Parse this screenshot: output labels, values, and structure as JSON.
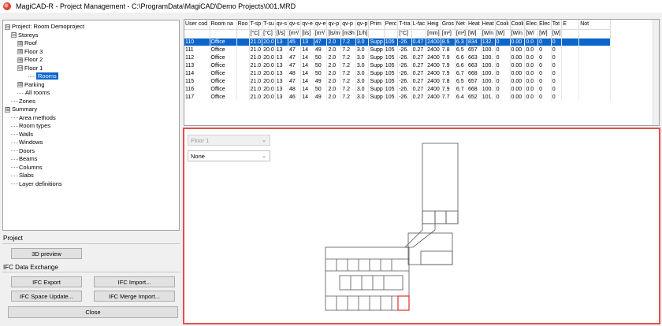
{
  "window": {
    "title": "MagiCAD-R - Project Management - C:\\ProgramData\\MagiCAD\\Demo Projects\\001.MRD"
  },
  "tree": {
    "items": [
      {
        "label": "Project: Room Demoproject",
        "toggle": "⊟"
      },
      {
        "label": "Storeys",
        "toggle": "⊟"
      },
      {
        "label": "Roof",
        "toggle": "⊞"
      },
      {
        "label": "Floor 3",
        "toggle": "⊞"
      },
      {
        "label": "Floor 2",
        "toggle": "⊞"
      },
      {
        "label": "Floor 1",
        "toggle": "⊟"
      },
      {
        "label": "Rooms",
        "toggle": ""
      },
      {
        "label": "Parking",
        "toggle": "⊞"
      },
      {
        "label": "All rooms",
        "toggle": ""
      },
      {
        "label": "Zones",
        "toggle": ""
      },
      {
        "label": "Summary",
        "toggle": "⊞"
      },
      {
        "label": "Area methods",
        "toggle": ""
      },
      {
        "label": "Room types",
        "toggle": ""
      },
      {
        "label": "Walls",
        "toggle": ""
      },
      {
        "label": "Windows",
        "toggle": ""
      },
      {
        "label": "Doors",
        "toggle": ""
      },
      {
        "label": "Beams",
        "toggle": ""
      },
      {
        "label": "Columns",
        "toggle": ""
      },
      {
        "label": "Slabs",
        "toggle": ""
      },
      {
        "label": "Layer definitions",
        "toggle": ""
      }
    ]
  },
  "project_section": {
    "label": "Project",
    "preview_button": "3D preview"
  },
  "ifc_section": {
    "label": "IFC Data Exchange",
    "export_button": "IFC Export",
    "import_button": "IFC Import...",
    "space_update_button": "IFC Space Update...",
    "merge_import_button": "IFC Merge Import..."
  },
  "close_button": "Close",
  "grid": {
    "headers": [
      "User cod",
      "Room na",
      "Roo",
      "T-sp",
      "T-su",
      "qv-s",
      "qv-s",
      "qv-e",
      "qv-e",
      "qv-p",
      "qv-p",
      "qv-p",
      "Prim",
      "Perc",
      "T-tra",
      "L-fac",
      "Heig",
      "Gros",
      "Net",
      "Heat",
      "Heat",
      "Cooli",
      "Cooli",
      "Elec",
      "Elec",
      "Tot",
      "E",
      "Not"
    ],
    "units": [
      "",
      "",
      "",
      "[°C]",
      "[°C]",
      "[l/s]",
      "[m³/",
      "[l/s]",
      "[m³/",
      "[ls/m",
      "[m3h",
      "[1/h]",
      "",
      "",
      "[°C]",
      "",
      "[mm]",
      "[m²]",
      "[m²]",
      "[W]",
      "[W/n",
      "[W]",
      "[W/n",
      "[W/",
      "[W]",
      "[W]",
      "",
      ""
    ],
    "rows": [
      [
        "110",
        "Office",
        "",
        "21.0",
        "20.0",
        "13",
        "45",
        "13",
        "47",
        "2.0",
        "7.2",
        "3.0",
        "Supp",
        "105",
        "-26.",
        "0.47",
        "2400",
        "8.5",
        "6.3",
        "834",
        "132.",
        "0",
        "0.00",
        "0.0",
        "0",
        "0",
        "",
        ""
      ],
      [
        "111",
        "Office",
        "",
        "21.0",
        "20.0",
        "13",
        "47",
        "14",
        "49",
        "2.0",
        "7.2",
        "3.0",
        "Supp",
        "105",
        "-26.",
        "0.27",
        "2400",
        "7.8",
        "6.5",
        "657",
        "100.",
        "0",
        "0.00",
        "0.0",
        "0",
        "0",
        "",
        ""
      ],
      [
        "112",
        "Office",
        "",
        "21.0",
        "20.0",
        "13",
        "47",
        "14",
        "50",
        "2.0",
        "7.2",
        "3.0",
        "Supp",
        "105",
        "-26.",
        "0.27",
        "2400",
        "7.9",
        "6.6",
        "663",
        "100.",
        "0",
        "0.00",
        "0.0",
        "0",
        "0",
        "",
        ""
      ],
      [
        "113",
        "Office",
        "",
        "21.0",
        "20.0",
        "13",
        "47",
        "14",
        "50",
        "2.0",
        "7.2",
        "3.0",
        "Supp",
        "105",
        "-26.",
        "0.27",
        "2400",
        "7.9",
        "6.6",
        "663",
        "100.",
        "0",
        "0.00",
        "0.0",
        "0",
        "0",
        "",
        ""
      ],
      [
        "114",
        "Office",
        "",
        "21.0",
        "20.0",
        "13",
        "48",
        "14",
        "50",
        "2.0",
        "7.2",
        "3.0",
        "Supp",
        "105",
        "-26.",
        "0.27",
        "2400",
        "7.9",
        "6.7",
        "668",
        "100.",
        "0",
        "0.00",
        "0.0",
        "0",
        "0",
        "",
        ""
      ],
      [
        "115",
        "Office",
        "",
        "21.0",
        "20.0",
        "13",
        "47",
        "14",
        "49",
        "2.0",
        "7.2",
        "3.0",
        "Supp",
        "105",
        "-26.",
        "0.27",
        "2400",
        "7.8",
        "6.5",
        "657",
        "100.",
        "0",
        "0.00",
        "0.0",
        "0",
        "0",
        "",
        ""
      ],
      [
        "116",
        "Office",
        "",
        "21.0",
        "20.0",
        "13",
        "48",
        "14",
        "50",
        "2.0",
        "7.2",
        "3.0",
        "Supp",
        "105",
        "-26.",
        "0.27",
        "2400",
        "7.9",
        "6.7",
        "668",
        "100.",
        "0",
        "0.00",
        "0.0",
        "0",
        "0",
        "",
        ""
      ],
      [
        "117",
        "Office",
        "",
        "21.0",
        "20.0",
        "13",
        "46",
        "14",
        "49",
        "2.0",
        "7.2",
        "3.0",
        "Supp",
        "105",
        "-26.",
        "0.27",
        "2400",
        "7.7",
        "6.4",
        "652",
        "101.",
        "0",
        "0.00",
        "0.0",
        "0",
        "0",
        "",
        ""
      ]
    ]
  },
  "plan": {
    "floor_select": "Floor 1",
    "filter_select": "None",
    "highlight_color": "#e03030"
  }
}
